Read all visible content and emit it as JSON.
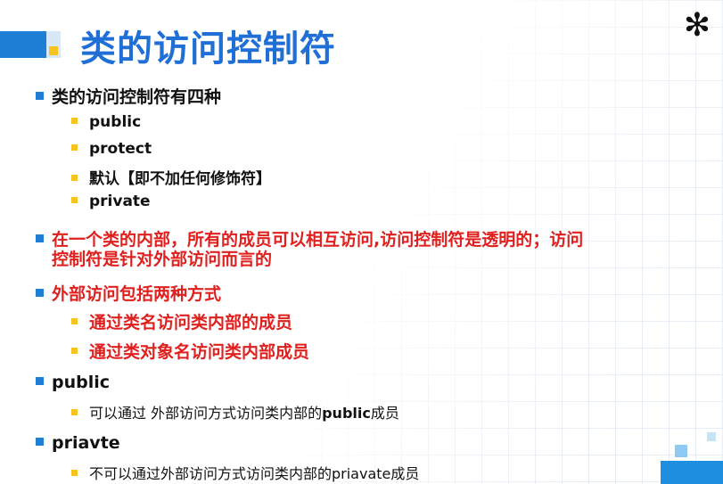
{
  "slide": {
    "title": "类的访问控制符",
    "corner_glyph": "✻",
    "colors": {
      "title": "#1f6fd6",
      "accent_blue": "#1f7fd6",
      "accent_yellow": "#f6c51d",
      "highlight_red": "#e0201e"
    },
    "bullets": [
      {
        "text": "类的访问控制符有四种",
        "children": [
          "public",
          "protect",
          "默认【即不加任何修饰符】",
          "private"
        ]
      },
      {
        "text_line1": "在一个类的内部，所有的成员可以相互访问,访问控制符是透明的；访问",
        "text_line2": "控制符是针对外部访问而言的"
      },
      {
        "text": "外部访问包括两种方式",
        "children": [
          "通过类名访问类内部的成员",
          "通过类对象名访问类内部成员"
        ]
      },
      {
        "text": "public",
        "children": [
          {
            "pre": "可以通过 外部访问方式访问类内部的",
            "keyword": "public",
            "post": "成员"
          }
        ]
      },
      {
        "text": "priavte",
        "children": [
          "不可以通过外部访问方式访问类内部的priavate成员"
        ]
      }
    ]
  }
}
